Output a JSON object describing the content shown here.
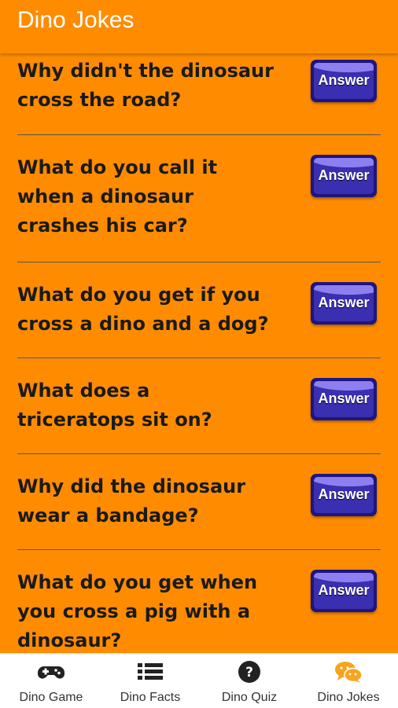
{
  "app": {
    "title": "Dino Jokes"
  },
  "jokes": [
    {
      "question": "Why didn't the dinosaur cross the road?",
      "button": "Answer"
    },
    {
      "question": "What do you call it when a dinosaur crashes his car?",
      "button": "Answer"
    },
    {
      "question": "What do you get if you cross a dino and a dog?",
      "button": "Answer"
    },
    {
      "question": "What does a triceratops sit on?",
      "button": "Answer"
    },
    {
      "question": "Why did the dinosaur wear a bandage?",
      "button": "Answer"
    },
    {
      "question": "What do you get when you cross a pig with a dinosaur?",
      "button": "Answer"
    }
  ],
  "nav": [
    {
      "label": "Dino Game",
      "icon": "gamepad-icon"
    },
    {
      "label": "Dino Facts",
      "icon": "list-icon"
    },
    {
      "label": "Dino Quiz",
      "icon": "question-circle-icon"
    },
    {
      "label": "Dino Jokes",
      "icon": "chat-bubbles-icon",
      "active": true
    }
  ],
  "colors": {
    "background": "#FF8C00",
    "button": "#1E1580",
    "active_icon": "#F7A520"
  }
}
